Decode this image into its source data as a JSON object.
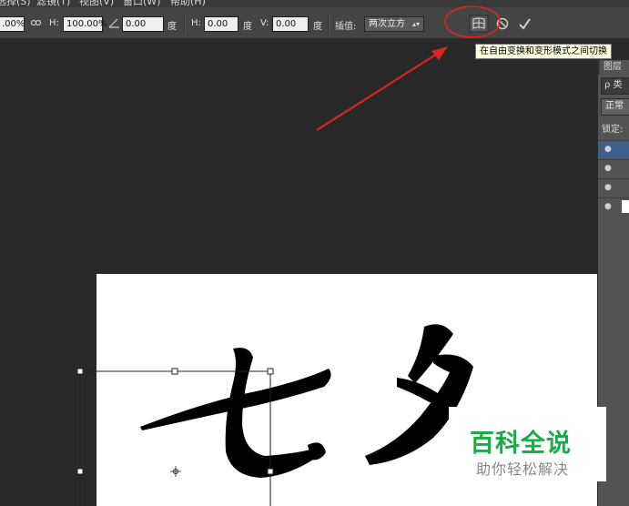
{
  "menu": [
    "选择(S)",
    "滤镜(T)",
    "视图(V)",
    "窗口(W)",
    "帮助(H)"
  ],
  "options": {
    "w_value": ".00%",
    "link_icon": "link-icon",
    "h_label": "H:",
    "h_value": "100.00%",
    "angle_value": "0.00",
    "degree_unit": "度",
    "skew_h_label": "H:",
    "skew_h_value": "0.00",
    "skew_h_unit": "度",
    "skew_v_label": "V:",
    "skew_v_value": "0.00",
    "skew_v_unit": "度",
    "interp_label": "插值:",
    "interp_value": "两次立方",
    "warp_icon": "warp-toggle-icon",
    "cancel_icon": "cancel-transform-icon",
    "commit_icon": "commit-check-icon"
  },
  "tooltip": "在自由变换和变形模式之间切换",
  "layers_panel": {
    "tab": "图层",
    "search": "ρ 类",
    "blend": "正常",
    "lock": "锁定:"
  },
  "canvas": {
    "text": "七夕"
  },
  "watermark": {
    "title": "百科全说",
    "subtitle": "助你轻松解决"
  },
  "colors": {
    "annotation_red": "#d9261c",
    "watermark_green": "#1aab4a"
  }
}
